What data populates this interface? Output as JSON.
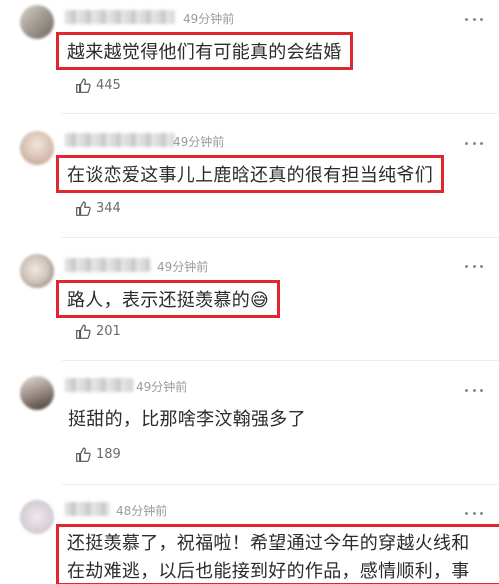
{
  "comments": [
    {
      "time": "49分钟前",
      "text": "越来越觉得他们有可能真的会结婚",
      "likes": "445",
      "highlighted": true
    },
    {
      "time": "49分钟前",
      "text": "在谈恋爱这事儿上鹿晗还真的很有担当纯爷们",
      "likes": "344",
      "highlighted": true
    },
    {
      "time": "49分钟前",
      "text": "路人，表示还挺羡慕的😅",
      "likes": "201",
      "highlighted": true
    },
    {
      "time": "49分钟前",
      "text": "挺甜的，比那啥李汶翰强多了",
      "likes": "189",
      "highlighted": false
    },
    {
      "time": "48分钟前",
      "text_line1": "还挺羡慕了，祝福啦！希望通过今年的穿越火线和",
      "text_line2": "在劫难逃，以后也能接到好的作品，感情顺利，事",
      "highlighted": true
    }
  ],
  "icons": {
    "like": "thumbs-up-icon",
    "more": "more-dots-icon"
  },
  "colors": {
    "highlight_border": "#e0262f",
    "meta_text": "#9a9a9a"
  }
}
